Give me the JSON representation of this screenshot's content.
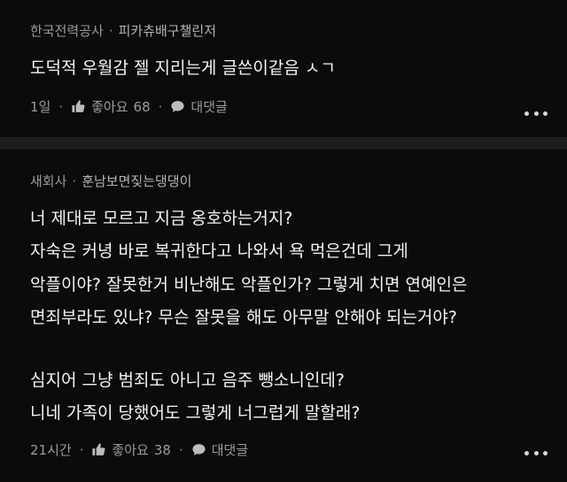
{
  "comments": [
    {
      "company": "한국전력공사",
      "nickname": "피카츄배구챌린저",
      "lines": [
        "도덕적 우월감 젤 지리는게 글쓴이같음 ㅅㄱ"
      ],
      "time": "1일",
      "like_label": "좋아요",
      "like_count": "68",
      "reply_label": "대댓글"
    },
    {
      "company": "새회사",
      "nickname": "훈남보면짖는댕댕이",
      "lines": [
        "너 제대로 모르고 지금 옹호하는거지?",
        "자숙은 커녕 바로 복귀한다고 나와서 욕 먹은건데 그게",
        "악플이야? 잘못한거 비난해도 악플인가? 그렇게 치면 연예인은",
        "면죄부라도 있냐? 무슨 잘못을 해도 아무말 안해야 되는거야?",
        "",
        "심지어 그냥 범죄도 아니고 음주 뺑소니인데?",
        "니네 가족이 당했어도 그렇게 너그럽게 말할래?"
      ],
      "time": "21시간",
      "like_label": "좋아요",
      "like_count": "38",
      "reply_label": "대댓글"
    }
  ],
  "separator": "·",
  "icons": {
    "like": "thumbs-up-icon",
    "reply": "speech-bubble-icon",
    "more": "more-dots-icon"
  },
  "colors": {
    "background": "#0b0b0b",
    "divider": "#1d1d1d",
    "text": "#f3f3f3",
    "meta": "#9a9a9a"
  }
}
